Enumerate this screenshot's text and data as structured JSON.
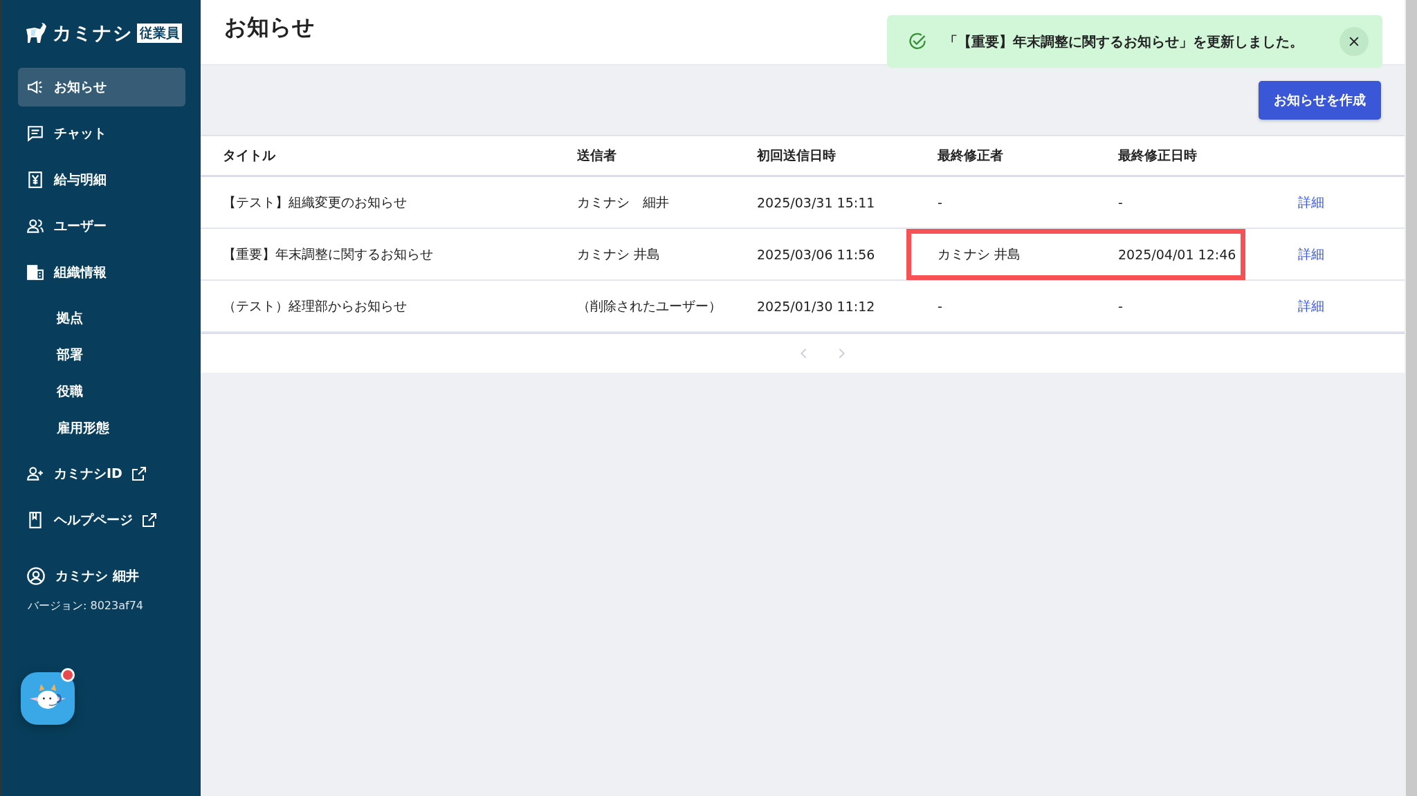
{
  "sidebar": {
    "logo": {
      "text": "カミナシ",
      "badge": "従業員"
    },
    "items": [
      {
        "label": "お知らせ",
        "selected": true
      },
      {
        "label": "チャット",
        "selected": false
      },
      {
        "label": "給与明細",
        "selected": false
      },
      {
        "label": "ユーザー",
        "selected": false
      },
      {
        "label": "組織情報",
        "selected": false,
        "children": [
          {
            "label": "拠点",
            "selected": false
          },
          {
            "label": "部署",
            "selected": false
          },
          {
            "label": "役職",
            "selected": false
          },
          {
            "label": "雇用形態",
            "selected": false
          }
        ]
      }
    ],
    "links": [
      {
        "label": "カミナシID",
        "external": true
      },
      {
        "label": "ヘルプページ",
        "external": true
      }
    ],
    "user": {
      "name": "カミナシ 細井"
    },
    "version": "バージョン: 8023af74",
    "support_badge": true
  },
  "page": {
    "title": "お知らせ"
  },
  "toast": {
    "message": "「【重要】年末調整に関するお知らせ」を更新しました。"
  },
  "create_button": "お知らせを作成",
  "table": {
    "columns": [
      "タイトル",
      "送信者",
      "初回送信日時",
      "最終修正者",
      "最終修正日時"
    ],
    "rows": [
      {
        "title": "【テスト】組織変更のお知らせ",
        "sender": "カミナシ　細井",
        "first_sent": "2025/03/31 15:11",
        "last_editor": "-",
        "last_edited": "-",
        "action": "詳細",
        "highlighted": false
      },
      {
        "title": "【重要】年末調整に関するお知らせ",
        "sender": "カミナシ 井島",
        "first_sent": "2025/03/06 11:56",
        "last_editor": "カミナシ 井島",
        "last_edited": "2025/04/01 12:46",
        "action": "詳細",
        "highlighted": true
      },
      {
        "title": "（テスト）経理部からお知らせ",
        "sender": "（削除されたユーザー）",
        "first_sent": "2025/01/30 11:12",
        "last_editor": "-",
        "last_edited": "-",
        "action": "詳細",
        "highlighted": false
      }
    ]
  },
  "pagination": {
    "prev_disabled": true,
    "next_disabled": true
  }
}
